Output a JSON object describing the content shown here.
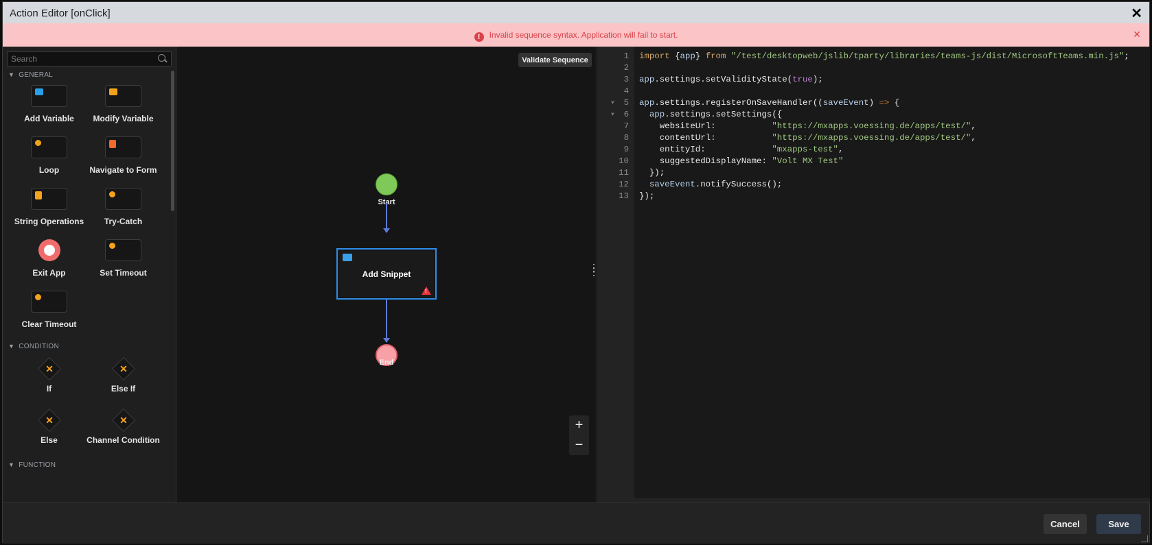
{
  "window": {
    "title": "Action Editor [onClick]"
  },
  "error": {
    "message": "Invalid sequence syntax. Application will fail to start."
  },
  "palette": {
    "search_placeholder": "Search",
    "sections": {
      "general": "GENERAL",
      "condition": "CONDITION",
      "function": "FUNCTION"
    },
    "general": [
      {
        "label": "Add Variable",
        "icon": "add-variable-icon",
        "color": "#2aa0e8"
      },
      {
        "label": "Modify Variable",
        "icon": "modify-variable-icon",
        "color": "#f2a31b"
      },
      {
        "label": "Loop",
        "icon": "loop-icon",
        "color": "#f2a31b"
      },
      {
        "label": "Navigate to Form",
        "icon": "navigate-form-icon",
        "color": "#ef6a2c"
      },
      {
        "label": "String Operations",
        "icon": "string-ops-icon",
        "color": "#f2a31b"
      },
      {
        "label": "Try-Catch",
        "icon": "try-catch-icon",
        "color": "#f2a31b"
      },
      {
        "label": "Exit App",
        "icon": "exit-app-icon",
        "color": "#f06b6b"
      },
      {
        "label": "Set Timeout",
        "icon": "set-timeout-icon",
        "color": "#f2a31b"
      },
      {
        "label": "Clear Timeout",
        "icon": "clear-timeout-icon",
        "color": "#f2a31b"
      }
    ],
    "condition": [
      {
        "label": "If"
      },
      {
        "label": "Else If"
      },
      {
        "label": "Else"
      },
      {
        "label": "Channel Condition"
      }
    ]
  },
  "canvas": {
    "validate_label": "Validate Sequence",
    "start_label": "Start",
    "end_label": "End",
    "snippet_label": "Add Snippet",
    "zoom_in": "+",
    "zoom_out": "−"
  },
  "code_lines": [
    "import {app} from \"/test/desktopweb/jslib/tparty/libraries/teams-js/dist/MicrosoftTeams.min.js\";",
    "",
    "app.settings.setValidityState(true);",
    "",
    "app.settings.registerOnSaveHandler((saveEvent) => {",
    "  app.settings.setSettings({",
    "    websiteUrl:           \"https://mxapps.voessing.de/apps/test/\",",
    "    contentUrl:           \"https://mxapps.voessing.de/apps/test/\",",
    "    entityId:             \"mxapps-test\",",
    "    suggestedDisplayName: \"Volt MX Test\"",
    "  });",
    "  saveEvent.notifySuccess();",
    "});"
  ],
  "footer": {
    "cancel_label": "Cancel",
    "save_label": "Save"
  },
  "colors": {
    "accent": "#2d8de8",
    "error": "#d9424a",
    "start": "#7ec957",
    "end": "#f7a0a6"
  }
}
